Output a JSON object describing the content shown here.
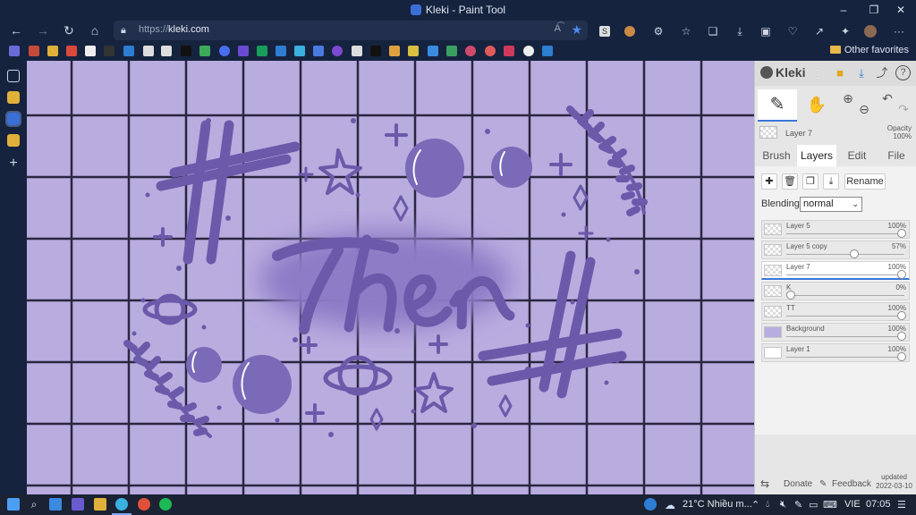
{
  "window": {
    "title": "Kleki - Paint Tool",
    "minimize": "–",
    "maximize": "❐",
    "close": "✕"
  },
  "addressbar": {
    "back": "←",
    "forward": "→",
    "reload": "↻",
    "home": "⌂",
    "url_proto": "https://",
    "url_host": "kleki.com",
    "read_aloud": "A͡",
    "favorite": "★",
    "more": "···"
  },
  "favorites": {
    "other_label": "Other favorites"
  },
  "canvas": {
    "colors": {
      "background": "#b9acdf",
      "grid": "#2a2640",
      "ink": "#6b5aaa",
      "blur": "#8d7cc6"
    },
    "text": "Ther"
  },
  "panel": {
    "logo": "Kleki",
    "current_layer": {
      "name": "Layer 7",
      "opacity_label": "Opacity",
      "opacity_value": "100%"
    },
    "tabs": [
      {
        "label": "Brush"
      },
      {
        "label": "Layers"
      },
      {
        "label": "Edit"
      },
      {
        "label": "File"
      }
    ],
    "active_tab": "Layers",
    "rename_label": "Rename",
    "blending_label": "Blending",
    "blending_value": "normal",
    "layers": [
      {
        "name": "Layer 5",
        "opacity": "100%",
        "level": 1.0
      },
      {
        "name": "Layer 5 copy",
        "opacity": "57%",
        "level": 0.57
      },
      {
        "name": "Layer 7",
        "opacity": "100%",
        "level": 1.0,
        "selected": true
      },
      {
        "name": "K",
        "opacity": "0%",
        "level": 0.0
      },
      {
        "name": "TT",
        "opacity": "100%",
        "level": 1.0
      },
      {
        "name": "Background",
        "opacity": "100%",
        "level": 1.0
      },
      {
        "name": "Layer 1",
        "opacity": "100%",
        "level": 1.0
      }
    ],
    "footer": {
      "donate": "Donate",
      "feedback": "Feedback",
      "updated_label": "updated",
      "updated_date": "2022-03-10"
    }
  },
  "taskbar": {
    "weather": "21°C  Nhiều m...",
    "language": "VIE",
    "time": "07:05"
  }
}
